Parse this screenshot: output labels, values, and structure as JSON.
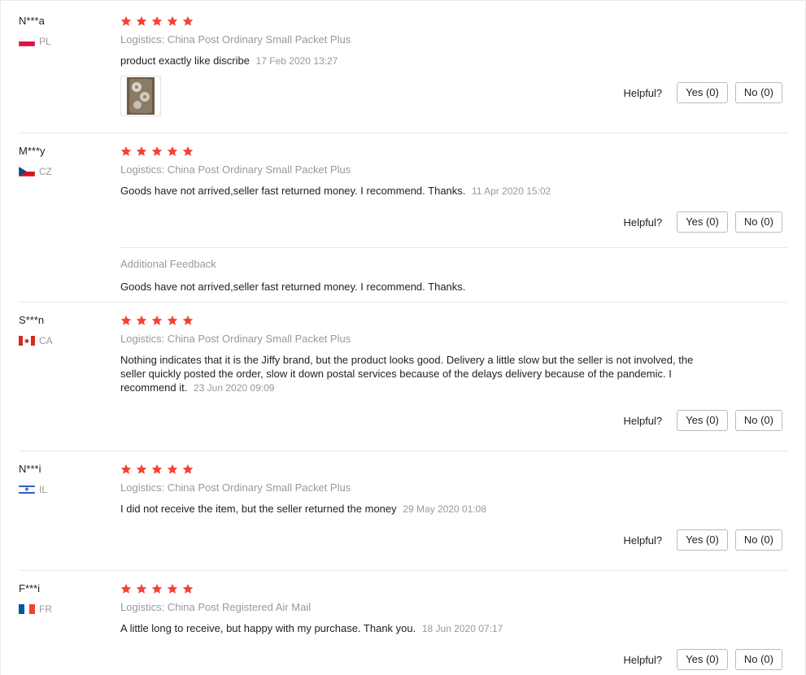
{
  "helpful_label": "Helpful?",
  "star_color": "#f44336",
  "reviews": [
    {
      "user": "N***a",
      "country": "PL",
      "flag": "flag-pl-icon",
      "rating": 5,
      "logistics": "Logistics: China Post Ordinary Small Packet Plus",
      "content": "product exactly like discribe",
      "date": "17 Feb 2020 13:27",
      "yes_label": "Yes (0)",
      "no_label": "No (0)"
    },
    {
      "user": "M***y",
      "country": "CZ",
      "flag": "flag-cz-icon",
      "rating": 5,
      "logistics": "Logistics: China Post Ordinary Small Packet Plus",
      "content": "Goods have not arrived,seller fast returned money. I recommend. Thanks.",
      "date": "11 Apr 2020 15:02",
      "yes_label": "Yes (0)",
      "no_label": "No (0)",
      "additional_label": "Additional Feedback",
      "additional_text": "Goods have not arrived,seller fast returned money. I recommend. Thanks."
    },
    {
      "user": "S***n",
      "country": "CA",
      "flag": "flag-ca-icon",
      "rating": 5,
      "logistics": "Logistics: China Post Ordinary Small Packet Plus",
      "content": "Nothing indicates that it is the Jiffy brand, but the product looks good. Delivery a little slow but the seller is not involved, the seller quickly posted the order, slow it down postal services because of the delays delivery because of the pandemic. I recommend it.",
      "date": "23 Jun 2020 09:09",
      "yes_label": "Yes (0)",
      "no_label": "No (0)"
    },
    {
      "user": "N***i",
      "country": "IL",
      "flag": "flag-il-icon",
      "rating": 5,
      "logistics": "Logistics: China Post Ordinary Small Packet Plus",
      "content": "I did not receive the item, but the seller returned the money",
      "date": "29 May 2020 01:08",
      "yes_label": "Yes (0)",
      "no_label": "No (0)"
    },
    {
      "user": "F***i",
      "country": "FR",
      "flag": "flag-fr-icon",
      "rating": 5,
      "logistics": "Logistics: China Post Registered Air Mail",
      "content": "A little long to receive, but happy with my purchase. Thank you.",
      "date": "18 Jun 2020 07:17",
      "yes_label": "Yes (0)",
      "no_label": "No (0)"
    }
  ]
}
